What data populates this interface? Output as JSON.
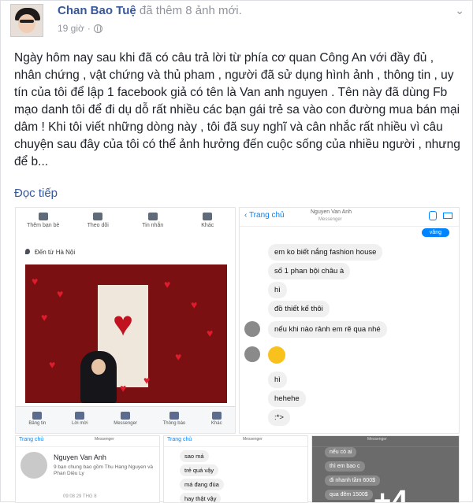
{
  "post": {
    "author": "Chan Bao Tuệ",
    "action": "đã thêm 8 ảnh mới.",
    "time": "19 giờ",
    "menu_icon": "chevron-down-icon",
    "body": "Ngày hôm nay sau khi đã có câu trả lời từ phía cơ quan Công An với đầy đủ , nhân chứng , vật chứng và thủ pham , người đã sử dụng hình ảnh , thông tin , uy tín của tôi để lập 1 facebook giả có tên là Van anh nguyen . Tên này đã dùng Fb mạo danh tôi để đi dụ dỗ rất nhiều các bạn gái trẻ sa vào con đường mua bán mại dâm ! Khi tôi viết những dòng này , tôi đã suy nghĩ và cân nhắc rất nhiều vì câu chuyện sau đây của tôi có thể ảnh hưởng đến cuộc sống của nhiều người , nhưng để b...",
    "read_more": "Đọc tiếp"
  },
  "photo1": {
    "tabs": [
      "Thêm bạn bè",
      "Theo dõi",
      "Tin nhắn",
      "Khác"
    ],
    "location": "Đến từ Hà Nội",
    "bottom_nav": [
      "Bảng tin",
      "Lời mời",
      "Messenger",
      "Thông báo",
      "Khác"
    ]
  },
  "photo2": {
    "back": "Trang chủ",
    "header_name": "Nguyen Van Anh",
    "header_sub": "Messenger",
    "sent_label": "vâng",
    "messages": [
      "em ko biết nắng fashion house",
      "số 1 phan bội châu à",
      "hì",
      "đồ thiết kế thôi",
      "nếu khi nào rảnh em rẽ qua nhé",
      "hì",
      "hehehe",
      ":*>"
    ]
  },
  "photo3": {
    "back": "Trang chủ",
    "sub": "Messenger",
    "name": "Nguyen Van Anh",
    "mutual": "9 bạn chung bao gồm Thu Hang Nguyen và Phan Diệu Ly",
    "date": "09:08 29 THG 8"
  },
  "photo4": {
    "back": "Trang chủ",
    "sub": "Messenger",
    "messages": [
      "sao má",
      "trẻ quá vậy",
      "má đang đùa",
      "hay thật vậy"
    ]
  },
  "photo5": {
    "sub": "Messenger",
    "messages": [
      "nếu có ai",
      "thì em bao c",
      "đi nhanh tầm 600$",
      "qua đêm 1500$"
    ],
    "more_count": "+4"
  }
}
